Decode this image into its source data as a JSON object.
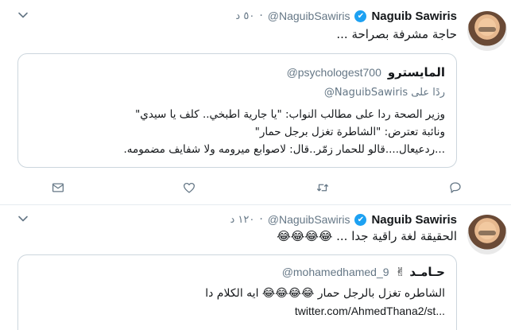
{
  "tweet1": {
    "author_name": "Naguib Sawiris",
    "verified_mark": "✔",
    "handle": "@NaguibSawiris",
    "separator": "·",
    "time": "٥٠ د",
    "text": "حاجة مشرفة بصراحة ...",
    "quote": {
      "name": "المايسترو",
      "handle": "@psychologest700",
      "reply_prefix": "ردًا على",
      "reply_mention": "@NaguibSawiris",
      "lines": [
        "وزير الصحة ردا على مطالب النواب: \"يا جارية اطبخي.. كلف يا سيدي\"",
        "ونائبة تعترض: \"الشاطرة تغزل برجل حمار\"",
        "...ردعيعال....قالو للحمار زمّر..قال: لاصوابع ميرومه ولا شفايف مضمومه."
      ]
    },
    "actions": [
      {
        "name": "reply",
        "icon": "reply-icon"
      },
      {
        "name": "retweet",
        "icon": "retweet-icon"
      },
      {
        "name": "like",
        "icon": "heart-icon"
      },
      {
        "name": "message",
        "icon": "mail-icon"
      }
    ]
  },
  "tweet2": {
    "author_name": "Naguib Sawiris",
    "verified_mark": "✔",
    "handle": "@NaguibSawiris",
    "separator": "·",
    "time": "١٢٠ د",
    "text": "الحقيقة لغة راقية جدا ... 😂😂😂😂",
    "quote": {
      "name": "حـامـد ✌",
      "handle": "@mohamedhamed_9",
      "line": "الشاطره تغزل بالرجل حمار 😂😂😂😂 ايه الكلام دا",
      "link": "twitter.com/AhmedThana2/st..."
    }
  },
  "colors": {
    "verified": "#1da1f2",
    "secondary_text": "#657786",
    "border": "#ccd6dd"
  }
}
